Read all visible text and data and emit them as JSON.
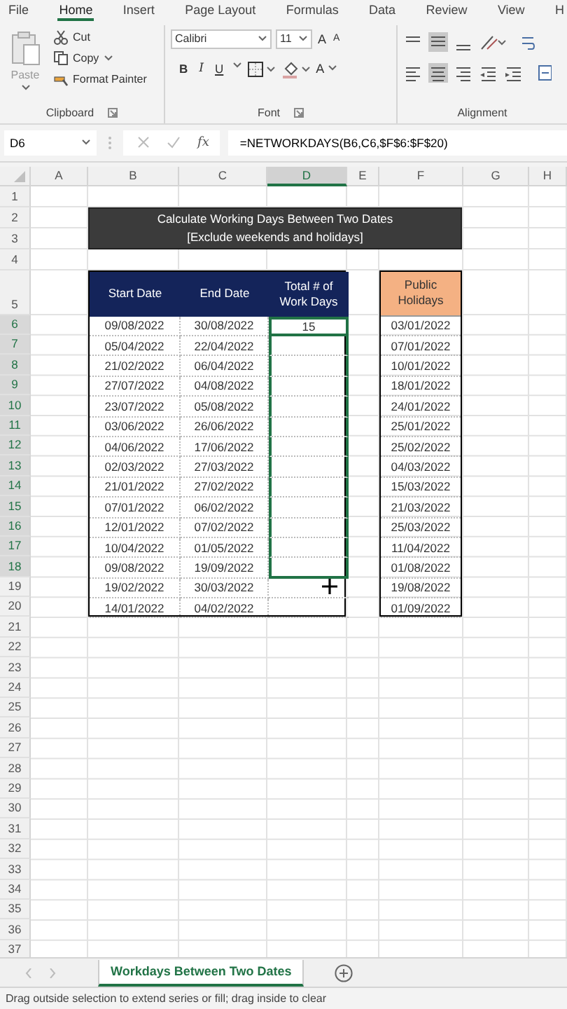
{
  "ribbon_tabs": [
    {
      "label": "File",
      "selected": false
    },
    {
      "label": "Home",
      "selected": true
    },
    {
      "label": "Insert",
      "selected": false
    },
    {
      "label": "Page Layout",
      "selected": false
    },
    {
      "label": "Formulas",
      "selected": false
    },
    {
      "label": "Data",
      "selected": false
    },
    {
      "label": "Review",
      "selected": false
    },
    {
      "label": "View",
      "selected": false
    },
    {
      "label": "H",
      "selected": false
    }
  ],
  "clipboard": {
    "paste": "Paste",
    "cut": "Cut",
    "copy": "Copy",
    "format_painter": "Format Painter",
    "label": "Clipboard"
  },
  "font": {
    "name": "Calibri",
    "size": "11",
    "grow": "A",
    "shrink": "A",
    "bold": "B",
    "italic": "I",
    "underline": "U",
    "font_color": "A",
    "label": "Font"
  },
  "alignment": {
    "label": "Alignment"
  },
  "name_box": "D6",
  "formula_bar": {
    "fx": "fx",
    "formula": "=NETWORKDAYS(B6,C6,$F$6:$F$20)"
  },
  "column_headers": [
    {
      "label": "A",
      "selected": false
    },
    {
      "label": "B",
      "selected": false
    },
    {
      "label": "C",
      "selected": false
    },
    {
      "label": "D",
      "selected": true
    },
    {
      "label": "E",
      "selected": false
    },
    {
      "label": "F",
      "selected": false
    },
    {
      "label": "G",
      "selected": false
    },
    {
      "label": "H",
      "selected": false
    }
  ],
  "row_headers": [
    {
      "label": "1",
      "selected": false
    },
    {
      "label": "2",
      "selected": false
    },
    {
      "label": "3",
      "selected": false
    },
    {
      "label": "4",
      "selected": false
    },
    {
      "label": "5",
      "selected": false
    },
    {
      "label": "6",
      "selected": true
    },
    {
      "label": "7",
      "selected": true
    },
    {
      "label": "8",
      "selected": true
    },
    {
      "label": "9",
      "selected": true
    },
    {
      "label": "10",
      "selected": true
    },
    {
      "label": "11",
      "selected": true
    },
    {
      "label": "12",
      "selected": true
    },
    {
      "label": "13",
      "selected": true
    },
    {
      "label": "14",
      "selected": true
    },
    {
      "label": "15",
      "selected": true
    },
    {
      "label": "16",
      "selected": true
    },
    {
      "label": "17",
      "selected": true
    },
    {
      "label": "18",
      "selected": true
    },
    {
      "label": "19",
      "selected": false
    },
    {
      "label": "20",
      "selected": false
    },
    {
      "label": "21",
      "selected": false
    },
    {
      "label": "22",
      "selected": false
    },
    {
      "label": "23",
      "selected": false
    },
    {
      "label": "24",
      "selected": false
    },
    {
      "label": "25",
      "selected": false
    },
    {
      "label": "26",
      "selected": false
    },
    {
      "label": "27",
      "selected": false
    },
    {
      "label": "28",
      "selected": false
    },
    {
      "label": "29",
      "selected": false
    },
    {
      "label": "30",
      "selected": false
    },
    {
      "label": "31",
      "selected": false
    },
    {
      "label": "32",
      "selected": false
    },
    {
      "label": "33",
      "selected": false
    },
    {
      "label": "34",
      "selected": false
    },
    {
      "label": "35",
      "selected": false
    },
    {
      "label": "36",
      "selected": false
    },
    {
      "label": "37",
      "selected": false
    }
  ],
  "title": [
    "Calculate Working Days Between Two Dates",
    "[Exclude weekends and holidays]"
  ],
  "table": {
    "columns": [
      "Start Date",
      "End Date",
      "Total # of Work Days"
    ],
    "rows": [
      {
        "start": "09/08/2022",
        "end": "30/08/2022",
        "total": "15",
        "selected": true,
        "active": true
      },
      {
        "start": "05/04/2022",
        "end": "22/04/2022",
        "selected": true,
        "active": false
      },
      {
        "start": "21/02/2022",
        "end": "06/04/2022",
        "selected": true,
        "active": false
      },
      {
        "start": "27/07/2022",
        "end": "04/08/2022",
        "selected": true,
        "active": false
      },
      {
        "start": "23/07/2022",
        "end": "05/08/2022",
        "selected": true,
        "active": false
      },
      {
        "start": "03/06/2022",
        "end": "26/06/2022",
        "selected": true,
        "active": false
      },
      {
        "start": "04/06/2022",
        "end": "17/06/2022",
        "selected": true,
        "active": false
      },
      {
        "start": "02/03/2022",
        "end": "27/03/2022",
        "selected": true,
        "active": false
      },
      {
        "start": "21/01/2022",
        "end": "27/02/2022",
        "selected": true,
        "active": false
      },
      {
        "start": "07/01/2022",
        "end": "06/02/2022",
        "selected": true,
        "active": false
      },
      {
        "start": "12/01/2022",
        "end": "07/02/2022",
        "selected": true,
        "active": false
      },
      {
        "start": "10/04/2022",
        "end": "01/05/2022",
        "selected": true,
        "active": false
      },
      {
        "start": "09/08/2022",
        "end": "19/09/2022",
        "selected": true,
        "active": false
      },
      {
        "start": "19/02/2022",
        "end": "30/03/2022",
        "selected": false,
        "active": false
      },
      {
        "start": "14/01/2022",
        "end": "04/02/2022",
        "selected": false,
        "active": false
      }
    ]
  },
  "holidays": {
    "header": "Public Holidays",
    "dates": [
      "03/01/2022",
      "07/01/2022",
      "10/01/2022",
      "18/01/2022",
      "24/01/2022",
      "25/01/2022",
      "25/02/2022",
      "04/03/2022",
      "15/03/2022",
      "21/03/2022",
      "25/03/2022",
      "11/04/2022",
      "01/08/2022",
      "19/08/2022",
      "01/09/2022"
    ]
  },
  "sheet_tabs": [
    {
      "label": "Workdays Between Two Dates",
      "selected": true
    }
  ],
  "status_bar": "Drag outside selection to extend series or fill; drag inside to clear"
}
